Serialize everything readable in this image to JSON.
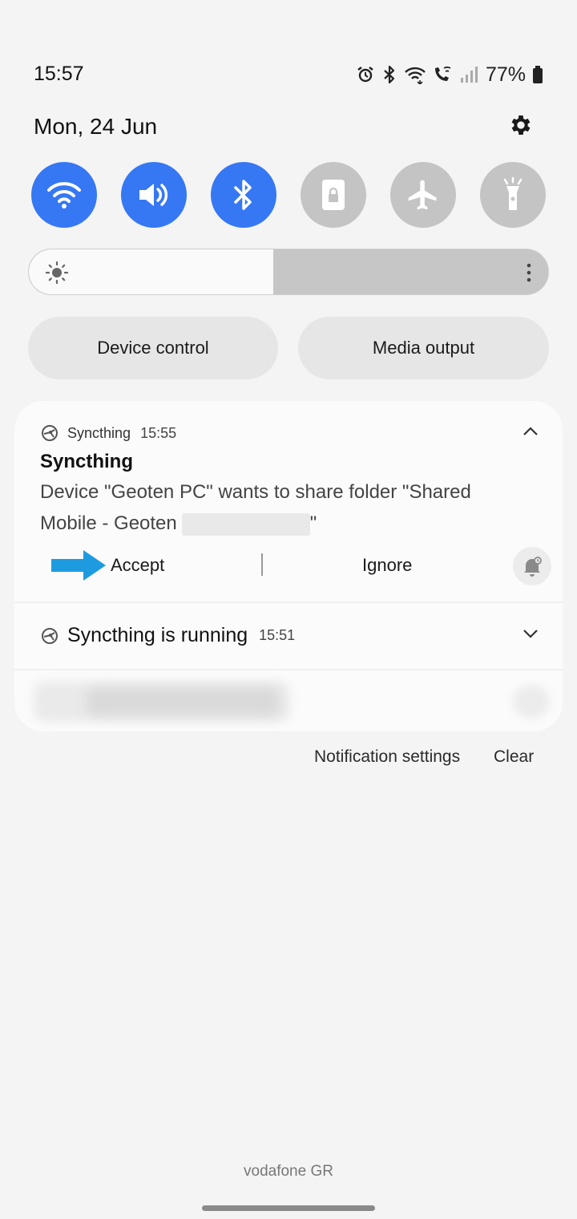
{
  "status_bar": {
    "time": "15:57",
    "battery": "77%",
    "icons": [
      "alarm-icon",
      "bluetooth-icon",
      "wifi-icon",
      "wifi-calling-icon",
      "signal-icon",
      "battery-icon"
    ]
  },
  "header": {
    "date": "Mon, 24 Jun",
    "settings_icon": "gear-icon"
  },
  "quick_settings": [
    {
      "name": "wifi",
      "icon": "wifi-icon",
      "state": "on"
    },
    {
      "name": "sound",
      "icon": "volume-icon",
      "state": "on"
    },
    {
      "name": "bluetooth",
      "icon": "bluetooth-icon",
      "state": "on"
    },
    {
      "name": "rotation-lock",
      "icon": "portrait-lock-icon",
      "state": "off"
    },
    {
      "name": "airplane-mode",
      "icon": "airplane-icon",
      "state": "off"
    },
    {
      "name": "flashlight",
      "icon": "flashlight-icon",
      "state": "off"
    }
  ],
  "brightness": {
    "level": 0.47
  },
  "buttons": {
    "device_control": "Device control",
    "media_output": "Media output"
  },
  "notifications": [
    {
      "app": "Syncthing",
      "time": "15:55",
      "title": "Syncthing",
      "body_line1": "Device \"Geoten PC\" wants to share folder \"Shared",
      "body_line2_prefix": "Mobile - Geoten",
      "body_line2_suffix": "\"",
      "actions": {
        "accept": "Accept",
        "ignore": "Ignore"
      }
    },
    {
      "title": "Syncthing is running",
      "time": "15:51"
    }
  ],
  "footer": {
    "notification_settings": "Notification settings",
    "clear": "Clear",
    "carrier": "vodafone GR"
  },
  "colors": {
    "accent": "#3678f3",
    "tile_off": "#c4c4c4",
    "annotation_arrow": "#1e9be0",
    "background": "#f4f4f4"
  }
}
